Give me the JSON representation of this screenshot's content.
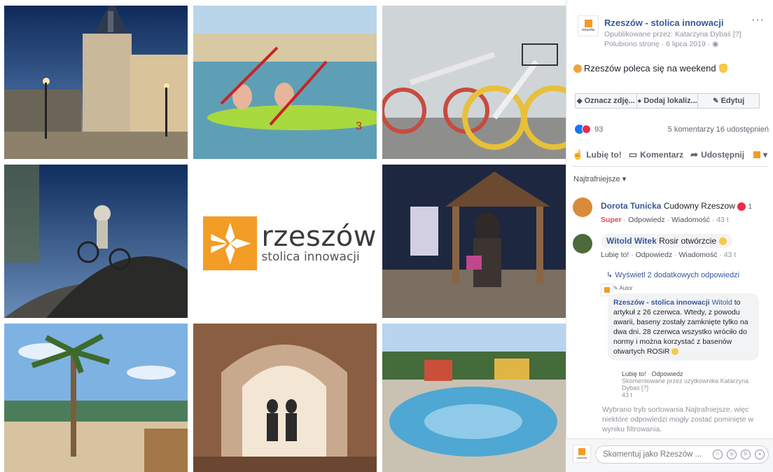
{
  "post": {
    "page_name": "Rzeszów - stolica innowacji",
    "published_by": "Opublikowane przez: Katarzyna Dybaś [?]",
    "liked_date": "Polubiono stronę · 6 lipca 2019 ·",
    "text": "Rzeszów poleca się na weekend",
    "more_label": "···"
  },
  "actions": {
    "tag_photo": "Oznacz zdję...",
    "add_location": "Dodaj lokaliz...",
    "edit": "Edytuj"
  },
  "stats": {
    "reactions_count": "93",
    "comments_shares": "5 komentarzy  16 udostępnień"
  },
  "share_bar": {
    "like": "Lubię to!",
    "comment": "Komentarz",
    "share": "Udostępnij"
  },
  "sorting": {
    "label": "Najtrafniejsze ▾"
  },
  "comments": [
    {
      "author": "Dorota Tunicka",
      "text": "Cudowny Rzeszow",
      "reaction_count": "1",
      "reaction_label": "Super",
      "reply": "Odpowiedz",
      "message": "Wiadomość",
      "time": "43 t"
    },
    {
      "author": "Witold Witek",
      "text": "Rosir otwórzcie",
      "like": "Lubię to!",
      "reply": "Odpowiedz",
      "message": "Wiadomość",
      "time": "43 t"
    }
  ],
  "more_replies": "Wyświetl 2 dodatkowych odpowiedzi",
  "page_reply": {
    "badge": "Autor",
    "author": "Rzeszów - stolica innowacji",
    "mention": "Witold",
    "text": "to artykuł z 26 czerwca. Wtedy, z powodu awarii, baseny zostały zamknięte tylko na dwa dni. 28 czerwca wszystko wróciło do normy i można korzystać z basenów otwartych ROSiR",
    "like": "Lubię to!",
    "reply": "Odpowiedz",
    "commented_by": "Skomentowane przez użytkownika Katarzyna Dybaś [?]",
    "time": "43 t"
  },
  "filter_note": "Wybrano tryb sortowania Najtrafniejsze, więc niektóre odpowiedzi mogły zostać pominięte w wyniku filtrowania.",
  "composer": {
    "placeholder": "Skomentuj jako Rzeszów ..."
  },
  "logo": {
    "name": "rzeszów",
    "tagline": "stolica innowacji",
    "avatar_mini": "rzeszów"
  },
  "colors": {
    "brand_orange": "#f39c26",
    "link_blue": "#365899",
    "meta_gray": "#90949c"
  }
}
